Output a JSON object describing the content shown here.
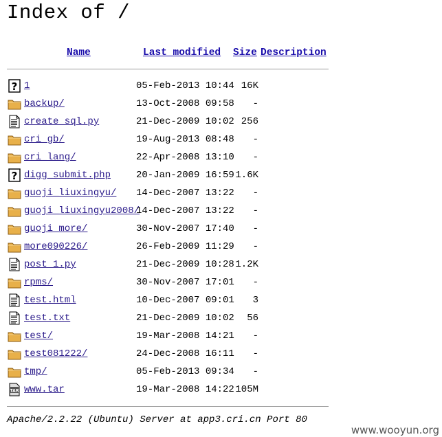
{
  "title": "Index of /",
  "columns": {
    "name": "Name",
    "last_modified": "Last modified",
    "size": "Size",
    "description": "Description"
  },
  "rows": [
    {
      "icon": "unknown-file-icon",
      "name": "1",
      "modified": "05-Feb-2013 10:44",
      "size": "16K"
    },
    {
      "icon": "folder-icon",
      "name": "backup/",
      "modified": "13-Oct-2008 09:58",
      "size": "-"
    },
    {
      "icon": "text-file-icon",
      "name": "create_sql.py",
      "modified": "21-Dec-2009 10:02",
      "size": "256"
    },
    {
      "icon": "folder-icon",
      "name": "cri_gb/",
      "modified": "19-Aug-2013 08:48",
      "size": "-"
    },
    {
      "icon": "folder-icon",
      "name": "cri_lang/",
      "modified": "22-Apr-2008 13:10",
      "size": "-"
    },
    {
      "icon": "unknown-file-icon",
      "name": "digg_submit.php",
      "modified": "20-Jan-2009 16:59",
      "size": "1.6K"
    },
    {
      "icon": "folder-icon",
      "name": "guoji_liuxingyu/",
      "modified": "14-Dec-2007 13:22",
      "size": "-"
    },
    {
      "icon": "folder-icon",
      "name": "guoji_liuxingyu2008/",
      "modified": "14-Dec-2007 13:22",
      "size": "-"
    },
    {
      "icon": "folder-icon",
      "name": "guoji_more/",
      "modified": "30-Nov-2007 17:40",
      "size": "-"
    },
    {
      "icon": "folder-icon",
      "name": "more090226/",
      "modified": "26-Feb-2009 11:29",
      "size": "-"
    },
    {
      "icon": "text-file-icon",
      "name": "post_1.py",
      "modified": "21-Dec-2009 10:28",
      "size": "1.2K"
    },
    {
      "icon": "folder-icon",
      "name": "rpms/",
      "modified": "30-Nov-2007 17:01",
      "size": "-"
    },
    {
      "icon": "text-file-icon",
      "name": "test.html",
      "modified": "10-Dec-2007 09:01",
      "size": "3"
    },
    {
      "icon": "text-file-icon",
      "name": "test.txt",
      "modified": "21-Dec-2009 10:02",
      "size": "56"
    },
    {
      "icon": "folder-icon",
      "name": "test/",
      "modified": "19-Mar-2008 14:21",
      "size": "-"
    },
    {
      "icon": "folder-icon",
      "name": "test081222/",
      "modified": "24-Dec-2008 16:11",
      "size": "-"
    },
    {
      "icon": "folder-icon",
      "name": "tmp/",
      "modified": "05-Feb-2013 09:34",
      "size": "-"
    },
    {
      "icon": "tar-archive-icon",
      "name": "www.tar",
      "modified": "19-Mar-2008 14:22",
      "size": "105M"
    }
  ],
  "footer": "Apache/2.2.22 (Ubuntu) Server at app3.cri.cn Port 80",
  "watermark": "www.wooyun.org",
  "colors": {
    "link": "#2a1a8a",
    "header_link": "#1a0dab",
    "folder": "#e8b04a",
    "rule": "#9a9a9a"
  }
}
